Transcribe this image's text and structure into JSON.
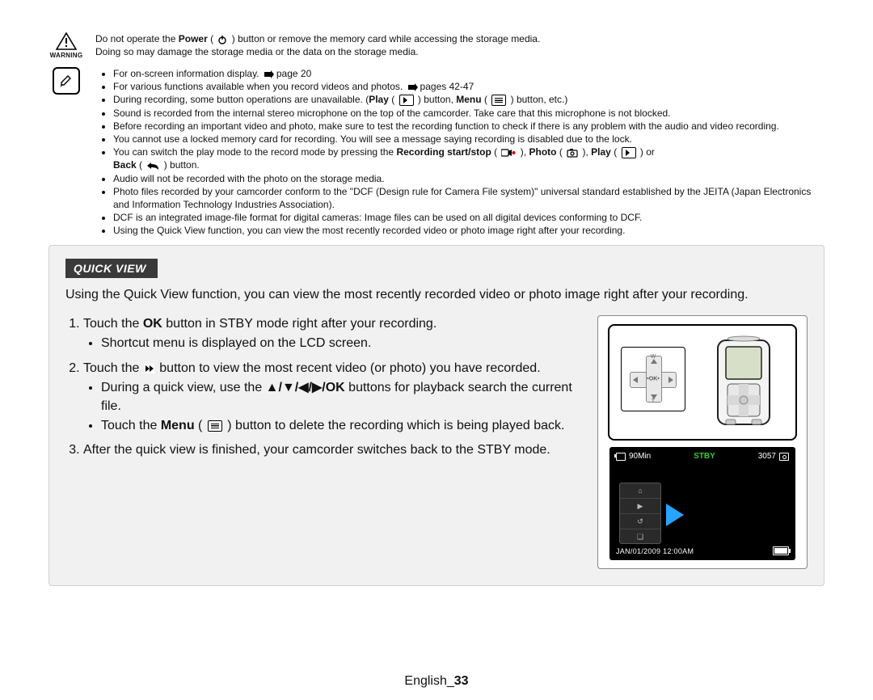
{
  "warning": {
    "label": "WARNING",
    "line1a": "Do not operate the ",
    "line1b": "Power",
    "line1c": " button or remove the memory card while accessing the storage media.",
    "line2": "Doing so may damage the storage media or the data on the storage media."
  },
  "notes": {
    "b0a": "For on-screen information display. ",
    "b0b": "page 20",
    "b1a": "For various functions available when you record videos and photos. ",
    "b1b": "pages 42-47",
    "b2a": "During recording, some button operations are unavailable. (",
    "b2b": "Play",
    "b2c": " button, ",
    "b2d": "Menu",
    "b2e": " button, etc.)",
    "b3": "Sound is recorded from the internal stereo microphone on the top of the camcorder. Take care that this microphone is not blocked.",
    "b4": "Before recording an important video and photo, make sure to test the recording function to check if there is any problem with the audio and video recording.",
    "b5": "You cannot use a locked memory card for recording. You will see a message saying recording is disabled due to the lock.",
    "b6a": "You can switch the play mode to the record mode by pressing the ",
    "b6b": "Recording start/stop",
    "b6c": ", ",
    "b6d": "Photo",
    "b6e": ", ",
    "b6f": "Play",
    "b6g": " or",
    "b6h": "Back",
    "b6i": " button.",
    "b7": "Audio will not be recorded with the photo on the storage media.",
    "b8": "Photo files recorded by your camcorder conform to the \"DCF (Design rule for Camera File system)\" universal standard established by the JEITA (Japan Electronics and Information Technology Industries Association).",
    "b9": "DCF is an integrated image-file format for digital cameras: Image files can be used on all digital devices conforming to DCF.",
    "b10": "Using the Quick View function, you can view the most recently recorded video or photo image right after your recording."
  },
  "quickview": {
    "heading": "QUICK VIEW",
    "intro": "Using the Quick View function, you can view the most recently recorded video or photo image right after your recording.",
    "s1a": "Touch the ",
    "s1b": "OK",
    "s1c": " button in STBY mode right after your recording.",
    "s1sub": "Shortcut menu is displayed on the LCD screen.",
    "s2a": "Touch the ",
    "s2b": " button to view the most recent video (or photo) you have recorded.",
    "s2suba": "During a quick view, use the ",
    "s2subb": " buttons for playback search the current file.",
    "s2subc_a": "Touch the ",
    "s2subc_b": "Menu",
    "s2subc_c": " button to delete the recording which is being played back.",
    "s3": "After the quick view is finished, your camcorder switches back to the STBY mode.",
    "navbuttons": "▲/▼/◀/▶/OK"
  },
  "camcorder_dpad": {
    "ok": "•OK•",
    "w": "W",
    "t": "T"
  },
  "lcd": {
    "time_left": "90Min",
    "status": "STBY",
    "count": "3057",
    "date": "JAN/01/2009 12:00AM",
    "menu_items": [
      "⌂",
      "▶",
      "↺",
      "❏"
    ]
  },
  "footer": {
    "lang": "English_",
    "page": "33"
  }
}
